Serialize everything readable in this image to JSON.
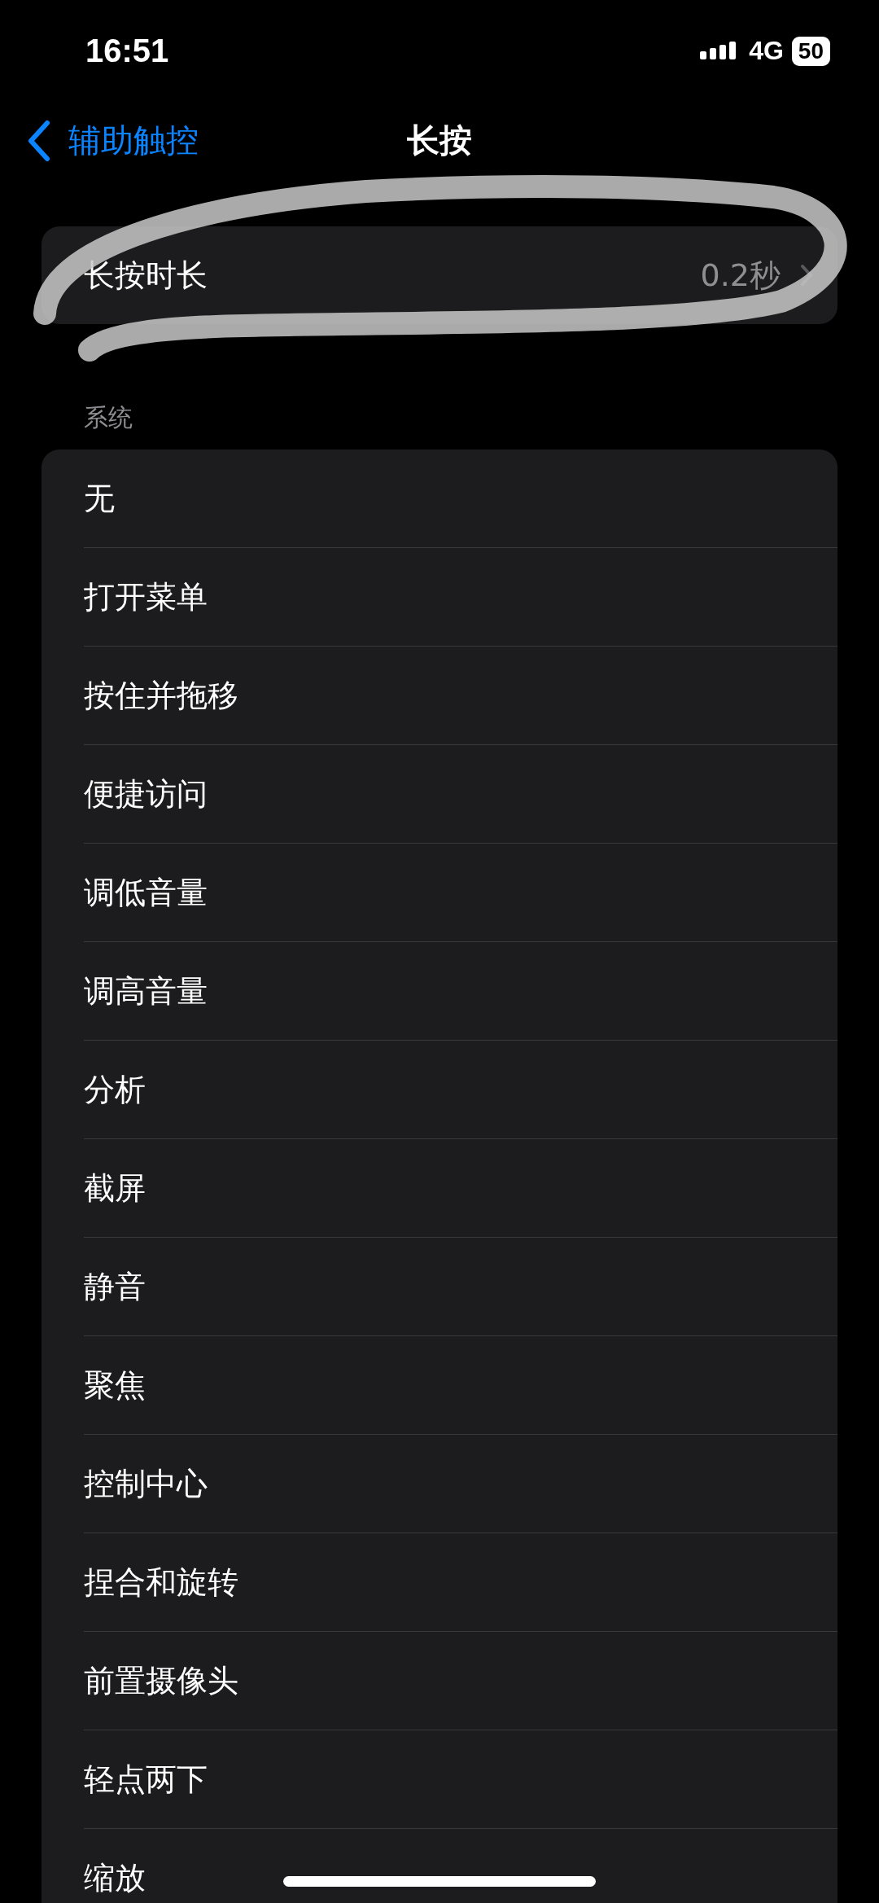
{
  "status_bar": {
    "time": "16:51",
    "network": "4G",
    "battery": "50"
  },
  "nav": {
    "back": "辅助触控",
    "title": "长按"
  },
  "duration": {
    "label": "长按时长",
    "value": "0.2秒"
  },
  "section": {
    "header": "系统",
    "items": [
      {
        "label": "无"
      },
      {
        "label": "打开菜单"
      },
      {
        "label": "按住并拖移"
      },
      {
        "label": "便捷访问"
      },
      {
        "label": "调低音量"
      },
      {
        "label": "调高音量"
      },
      {
        "label": "分析"
      },
      {
        "label": "截屏"
      },
      {
        "label": "静音"
      },
      {
        "label": "聚焦"
      },
      {
        "label": "控制中心"
      },
      {
        "label": "捏合和旋转"
      },
      {
        "label": "前置摄像头"
      },
      {
        "label": "轻点两下"
      },
      {
        "label": "缩放"
      }
    ]
  }
}
